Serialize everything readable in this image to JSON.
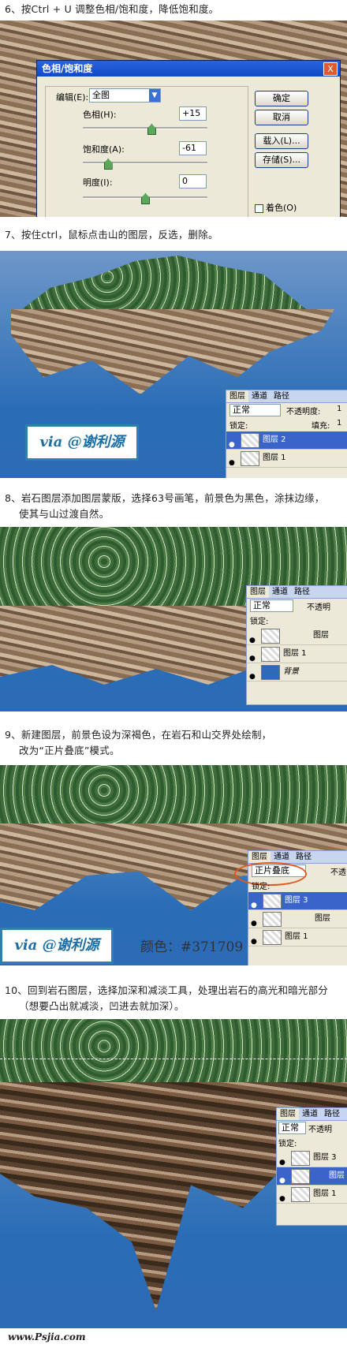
{
  "steps": [
    {
      "line1": "6、按Ctrl + U 调整色相/饱和度，降低饱和度。"
    },
    {
      "line1": "7、按住ctrl，鼠标点击山的图层，反选，删除。"
    },
    {
      "line1": "8、岩石图层添加图层蒙版，选择63号画笔，前景色为黑色，涂抹边缘，",
      "line2": "使其与山过渡自然。"
    },
    {
      "line1": "9、新建图层，前景色设为深褐色，在岩石和山交界处绘制，",
      "line2": "改为“正片叠底”模式。"
    },
    {
      "line1": "10、回到岩石图层，选择加深和减淡工具，处理出岩石的高光和暗光部分",
      "line2": "（想要凸出就减淡，凹进去就加深）。"
    }
  ],
  "dialog": {
    "title": "色相/饱和度",
    "edit_label": "编辑(E):",
    "edit_value": "全图",
    "hue_label": "色相(H):",
    "hue_value": "+15",
    "hue_level": 0.55,
    "sat_label": "饱和度(A):",
    "sat_value": "-61",
    "sat_level": 0.2,
    "light_label": "明度(I):",
    "light_value": "0",
    "light_level": 0.5,
    "ok": "确定",
    "cancel": "取消",
    "load": "载入(L)...",
    "save": "存储(S)...",
    "colorize": "着色(O)",
    "close": "X"
  },
  "layers7": {
    "tab1": "图层",
    "tab2": "通道",
    "tab3": "路径",
    "mode": "正常",
    "opacity_label": "不透明度:",
    "opacity_value": "1",
    "lock_label": "锁定:",
    "fill_label": "填充:",
    "fill_value": "1",
    "row1": "图层 2",
    "row2": "图层 1"
  },
  "layers8": {
    "tab1": "图层",
    "tab2": "通道",
    "tab3": "路径",
    "mode": "正常",
    "opacity_label": "不透明",
    "lock_label": "锁定:",
    "row1": "图层",
    "row2": "图层 1",
    "row3": "背景"
  },
  "layers9": {
    "tab1": "图层",
    "tab2": "通道",
    "tab3": "路径",
    "mode": "正片叠底",
    "opacity_label": "不透",
    "lock_label": "锁定:",
    "row1": "图层 3",
    "row2": "图层",
    "row3": "图层 1"
  },
  "layers10": {
    "tab1": "图层",
    "tab2": "通道",
    "tab3": "路径",
    "mode": "正常",
    "opacity_label": "不透明",
    "lock_label": "锁定:",
    "row1": "图层 3",
    "row2": "图层",
    "row3": "图层 1"
  },
  "watermark": "via @谢利源",
  "color_note": "颜色：#371709",
  "footer": "www.Psjia.com"
}
